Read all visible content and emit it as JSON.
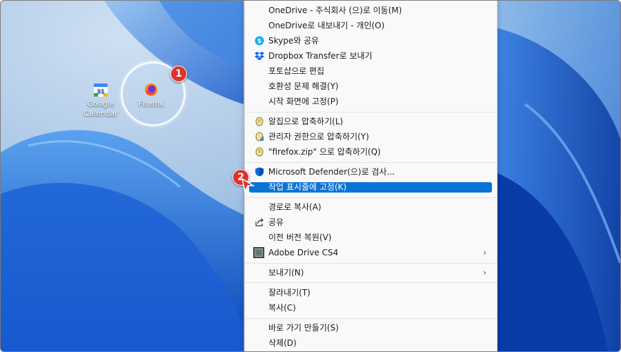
{
  "desktop": {
    "icons": [
      {
        "label": "Google Calendar",
        "label_line1": "Google",
        "label_line2": "Calendar"
      },
      {
        "label": "Firefox"
      }
    ],
    "badges": [
      "1",
      "2"
    ]
  },
  "menu": {
    "items": [
      {
        "label": "OneDrive - 주식회사 (으)로 이동(M)"
      },
      {
        "label": "OneDrive로 내보내기 - 개인(O)"
      },
      {
        "label": "Skype와 공유",
        "icon": "skype-icon"
      },
      {
        "label": "Dropbox Transfer로 보내기",
        "icon": "dropbox-icon"
      },
      {
        "label": "포토샵으로 편집"
      },
      {
        "label": "호환성 문제 해결(Y)"
      },
      {
        "label": "시작 화면에 고정(P)"
      },
      {
        "label": "알집으로 압축하기(L)",
        "icon": "alzip-icon"
      },
      {
        "label": "관리자 권한으로 압축하기(Y)",
        "icon": "alzip-admin-icon"
      },
      {
        "label": "\"firefox.zip\" 으로 압축하기(Q)",
        "icon": "alzip-icon"
      },
      {
        "label": "Microsoft Defender(으)로 검사...",
        "icon": "defender-shield-icon"
      },
      {
        "label": "작업 표시줄에 고정(K)",
        "selected": true
      },
      {
        "label": "경로로 복사(A)"
      },
      {
        "label": "공유",
        "icon": "share-icon"
      },
      {
        "label": "이전 버전 복원(V)"
      },
      {
        "label": "Adobe Drive CS4",
        "icon": "adobe-drive-icon",
        "submenu": true
      },
      {
        "label": "보내기(N)",
        "submenu": true
      },
      {
        "label": "잘라내기(T)"
      },
      {
        "label": "복사(C)"
      },
      {
        "label": "바로 가기 만들기(S)"
      },
      {
        "label": "삭제(D)"
      }
    ]
  },
  "colors": {
    "accent": "#0a74d6",
    "badge": "#e0322b"
  }
}
